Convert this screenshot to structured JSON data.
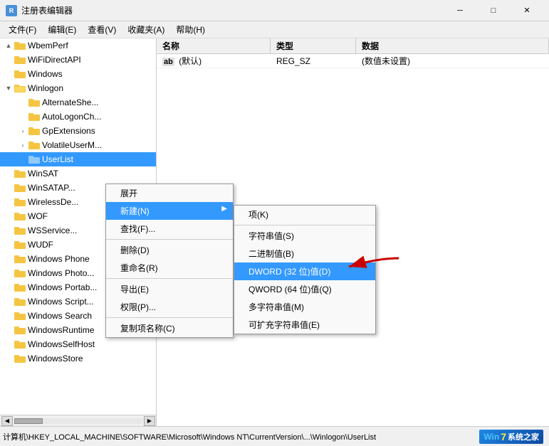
{
  "titleBar": {
    "icon": "R",
    "title": "注册表编辑器",
    "minBtn": "─",
    "maxBtn": "□",
    "closeBtn": "✕"
  },
  "menuBar": {
    "items": [
      "文件(F)",
      "编辑(E)",
      "查看(V)",
      "收藏夹(A)",
      "帮助(H)"
    ]
  },
  "tree": {
    "items": [
      {
        "indent": 0,
        "arrow": "▲",
        "label": "WbemPerf",
        "selected": false
      },
      {
        "indent": 0,
        "arrow": "",
        "label": "WiFiDirectAPI",
        "selected": false
      },
      {
        "indent": 0,
        "arrow": "",
        "label": "Windows",
        "selected": false
      },
      {
        "indent": 0,
        "arrow": "▼",
        "label": "Winlogon",
        "selected": false
      },
      {
        "indent": 1,
        "arrow": "",
        "label": "AlternateShe...",
        "selected": false
      },
      {
        "indent": 1,
        "arrow": "",
        "label": "AutoLogonCh...",
        "selected": false
      },
      {
        "indent": 1,
        "arrow": ">",
        "label": "GpExtensions",
        "selected": false
      },
      {
        "indent": 1,
        "arrow": ">",
        "label": "VolatileUserM...",
        "selected": false
      },
      {
        "indent": 1,
        "arrow": "",
        "label": "UserList",
        "selected": true
      },
      {
        "indent": 0,
        "arrow": "",
        "label": "WinSAT",
        "selected": false
      },
      {
        "indent": 0,
        "arrow": "",
        "label": "WinSATAP...",
        "selected": false
      },
      {
        "indent": 0,
        "arrow": "",
        "label": "WirelessDe...",
        "selected": false
      },
      {
        "indent": 0,
        "arrow": "",
        "label": "WOF",
        "selected": false
      },
      {
        "indent": 0,
        "arrow": "",
        "label": "WSService...",
        "selected": false
      },
      {
        "indent": 0,
        "arrow": "",
        "label": "WUDF",
        "selected": false
      },
      {
        "indent": 0,
        "arrow": "",
        "label": "Windows Phone",
        "selected": false
      },
      {
        "indent": 0,
        "arrow": "",
        "label": "Windows Photo...",
        "selected": false
      },
      {
        "indent": 0,
        "arrow": "",
        "label": "Windows Portab...",
        "selected": false
      },
      {
        "indent": 0,
        "arrow": "",
        "label": "Windows Script...",
        "selected": false
      },
      {
        "indent": 0,
        "arrow": "",
        "label": "Windows Search",
        "selected": false
      },
      {
        "indent": 0,
        "arrow": "",
        "label": "WindowsRuntime",
        "selected": false
      },
      {
        "indent": 0,
        "arrow": "",
        "label": "WindowsSelfHost",
        "selected": false
      },
      {
        "indent": 0,
        "arrow": "",
        "label": "WindowsStore",
        "selected": false
      }
    ]
  },
  "rightPanel": {
    "columns": [
      "名称",
      "类型",
      "数据"
    ],
    "rows": [
      {
        "name": "(默认)",
        "icon": "ab",
        "type": "REG_SZ",
        "data": "(数值未设置)"
      }
    ]
  },
  "contextMenu": {
    "items": [
      {
        "label": "展开",
        "hasSub": false,
        "separator": false
      },
      {
        "label": "新建(N)",
        "hasSub": true,
        "separator": false,
        "active": true
      },
      {
        "label": "查找(F)...",
        "hasSub": false,
        "separator": true
      },
      {
        "label": "删除(D)",
        "hasSub": false,
        "separator": false
      },
      {
        "label": "重命名(R)",
        "hasSub": false,
        "separator": false
      },
      {
        "label": "导出(E)",
        "hasSub": false,
        "separator": true
      },
      {
        "label": "权限(P)...",
        "hasSub": false,
        "separator": false
      },
      {
        "label": "复制项名称(C)",
        "hasSub": false,
        "separator": false
      }
    ]
  },
  "subMenu": {
    "items": [
      {
        "label": "项(K)",
        "active": false
      },
      {
        "label": "字符串值(S)",
        "active": false
      },
      {
        "label": "二进制值(B)",
        "active": false
      },
      {
        "label": "DWORD (32 位)值(D)",
        "active": true
      },
      {
        "label": "QWORD (64 位)值(Q)",
        "active": false
      },
      {
        "label": "多字符串值(M)",
        "active": false
      },
      {
        "label": "可扩充字符串值(E)",
        "active": false
      }
    ]
  },
  "statusBar": {
    "path": "计算机\\HKEY_LOCAL_MACHINE\\SOFTWARE\\Microsoft\\Windows NT\\CurrentVersion\\...\\Winlogon\\UserList",
    "logo": "Win7系统之家",
    "logoWin": "Win",
    "logoNum": "7",
    "logoText": "系统之家"
  }
}
